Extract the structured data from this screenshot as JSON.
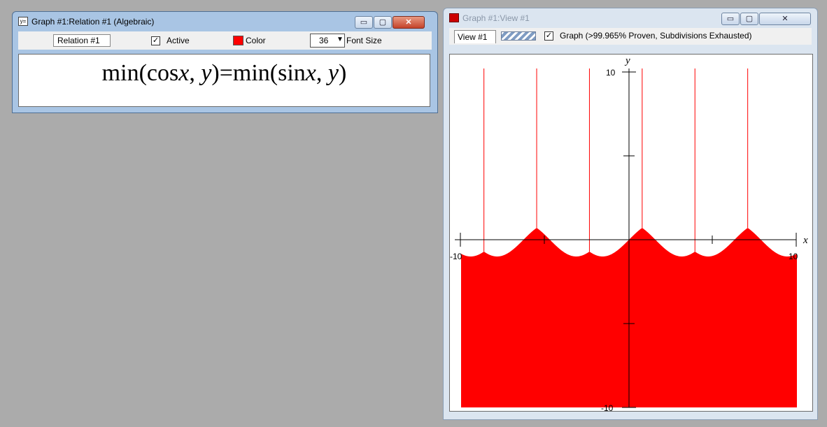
{
  "relation_window": {
    "title": "Graph #1:Relation #1 (Algebraic)",
    "relation_name": "Relation #1",
    "active_label": "Active",
    "active_checked": "✓",
    "color_label": "Color",
    "color_value": "#ff0000",
    "font_size_value": "36",
    "font_size_label": "Font Size",
    "formula": {
      "f1": "min(cos",
      "v1": "x",
      "s1": ", ",
      "v2": "y",
      "f2": ")=min(sin",
      "v3": "x",
      "s2": ", ",
      "v4": "y",
      "f3": ")"
    }
  },
  "view_window": {
    "title": "Graph #1:View #1",
    "view_tab": "View #1",
    "graph_checked": "✓",
    "graph_label": "Graph (>99.965% Proven, Subdivisions Exhausted)",
    "axis_x_label": "x",
    "axis_y_label": "y",
    "tick_y_top": "10",
    "tick_y_bottom": "-10",
    "tick_x_left": "-10",
    "tick_x_right": "10",
    "fill_color": "#ff0000"
  },
  "window_buttons": {
    "minimize_glyph": "▭",
    "maximize_glyph": "▢",
    "close_glyph": "✕"
  },
  "chart_data": {
    "type": "area",
    "relation": "min(cos x, y) = min(sin x, y)",
    "xlim": [
      -10,
      10
    ],
    "ylim": [
      -10,
      10
    ],
    "x_ticks": [
      -10,
      10
    ],
    "y_ticks": [
      -10,
      10
    ],
    "region": "y <= min(cos x, sin x), plus vertical rays where cos x = sin x",
    "vertical_rays_x": [
      -8.639,
      -5.498,
      -2.356,
      0.785,
      3.927,
      7.069
    ],
    "fill": "#ff0000"
  }
}
